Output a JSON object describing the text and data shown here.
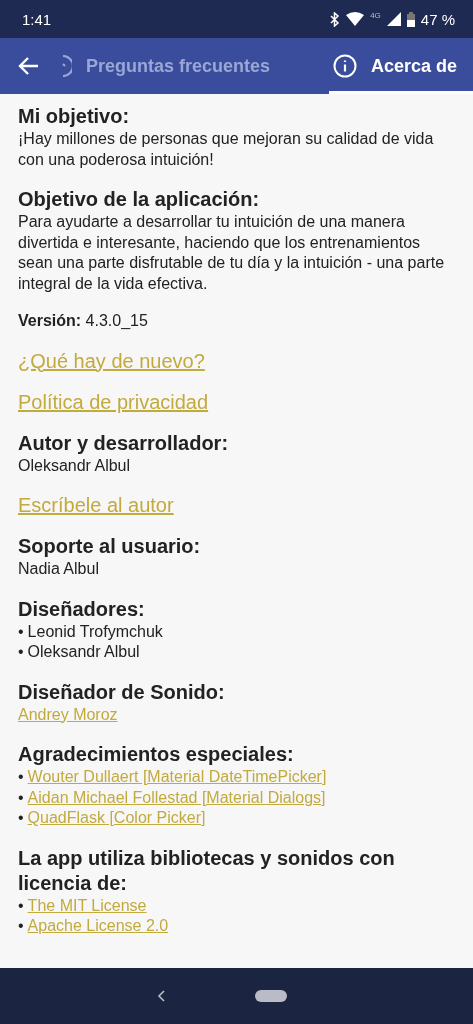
{
  "status_bar": {
    "time": "1:41",
    "network": "4G",
    "battery": "47 %"
  },
  "tabs": [
    {
      "label": "Preguntas frecuentes",
      "selected": false
    },
    {
      "label": "Acerca de",
      "selected": true
    }
  ],
  "content": [
    {
      "kind": "section",
      "title": "Mi objetivo:",
      "body": "¡Hay millones de personas que mejoran su calidad de vida con una poderosa intuición!"
    },
    {
      "kind": "section",
      "title": "Objetivo de la aplicación:",
      "body": "Para ayudarte a desarrollar tu intuición de una manera divertida e interesante, haciendo que los entrenamientos sean una parte disfrutable de tu día y la intuición - una parte integral de la vida efectiva."
    },
    {
      "kind": "version",
      "text": "**Versión:** 4.3.0_15"
    },
    {
      "kind": "link",
      "text": "¿Qué hay de nuevo?"
    },
    {
      "kind": "link",
      "text": "Política de privacidad"
    },
    {
      "kind": "section",
      "title": "Autor y desarrollador:",
      "body": "Oleksandr Albul"
    },
    {
      "kind": "link",
      "text": "Escríbele al autor"
    },
    {
      "kind": "section",
      "title": "Soporte al usuario:",
      "body": "Nadia Albul"
    },
    {
      "kind": "section",
      "title": "Diseñadores:",
      "items": [
        {
          "bullet": "•",
          "text": "Leonid Trofymchuk",
          "link": false
        },
        {
          "bullet": "•",
          "text": "Oleksandr Albul",
          "link": false
        }
      ]
    },
    {
      "kind": "section",
      "title": "Diseñador de Sonido:",
      "items": [
        {
          "text": "Andrey Moroz",
          "link": true
        }
      ]
    },
    {
      "kind": "section",
      "title": "Agradecimientos especiales:",
      "items": [
        {
          "bullet": "•",
          "text": "Wouter Dullaert [Material DateTimePicker]",
          "link": true
        },
        {
          "bullet": "•",
          "text": "Aidan Michael Follestad [Material Dialogs]",
          "link": true
        },
        {
          "bullet": "•",
          "text": "QuadFlask [Color Picker]",
          "link": true
        }
      ]
    },
    {
      "kind": "section",
      "title": "La app utiliza bibliotecas y sonidos con licencia de:",
      "items": [
        {
          "bullet": "•",
          "text": "The MIT License",
          "link": true
        },
        {
          "bullet": "•",
          "text": "Apache License 2.0",
          "link": true
        }
      ]
    }
  ]
}
